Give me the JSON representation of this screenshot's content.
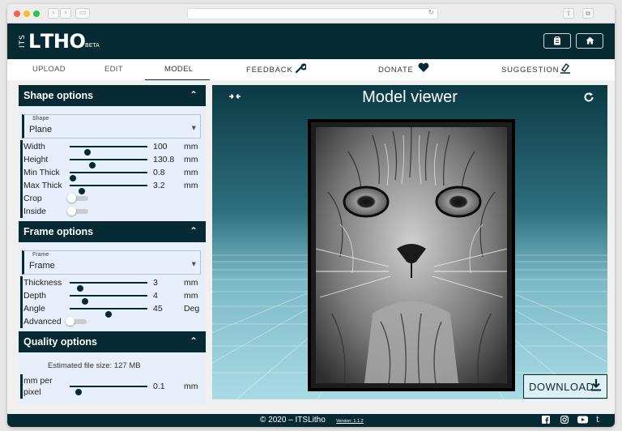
{
  "app": {
    "logo_prefix": "ITS",
    "logo_letter": "L",
    "logo_name": "THO",
    "logo_badge": "BETA",
    "header_icon_left": "clipboard-icon",
    "header_icon_right": "home-icon"
  },
  "tabs": [
    {
      "label": "UPLOAD",
      "active": false
    },
    {
      "label": "EDIT",
      "active": false
    },
    {
      "label": "MODEL",
      "active": true
    }
  ],
  "nav": {
    "feedback": "FEEDBACK",
    "donate": "DONATE",
    "suggestion": "SUGGESTION"
  },
  "shape_options": {
    "title": "Shape options",
    "select_label": "Shape",
    "select_value": "Plane",
    "sliders": [
      {
        "name": "Width",
        "value": "100",
        "unit": "mm",
        "fraction": 0.2
      },
      {
        "name": "Height",
        "value": "130.8",
        "unit": "mm",
        "fraction": 0.27
      },
      {
        "name": "Min Thick",
        "value": "0.8",
        "unit": "mm",
        "fraction": 0.0
      },
      {
        "name": "Max Thick",
        "value": "3.2",
        "unit": "mm",
        "fraction": 0.13
      }
    ],
    "toggles": [
      {
        "name": "Crop",
        "on": false
      },
      {
        "name": "Inside",
        "on": false
      }
    ]
  },
  "frame_options": {
    "title": "Frame options",
    "select_label": "Frame",
    "select_value": "Frame",
    "sliders": [
      {
        "name": "Thickness",
        "value": "3",
        "unit": "mm",
        "fraction": 0.1
      },
      {
        "name": "Depth",
        "value": "4",
        "unit": "mm",
        "fraction": 0.17
      },
      {
        "name": "Angle",
        "value": "45",
        "unit": "Deg",
        "fraction": 0.5
      }
    ],
    "toggles": [
      {
        "name": "Advanced",
        "on": false
      }
    ]
  },
  "quality_options": {
    "title": "Quality options",
    "estimate": "Estimated file size: 127 MB",
    "slider": {
      "name_line1": "mm per",
      "name_line2": "pixel",
      "value": "0.1",
      "unit": "mm",
      "fraction": 0.08
    }
  },
  "viewer": {
    "title": "Model viewer",
    "left_icon": "compress-arrows-icon",
    "right_icon": "refresh-icon",
    "download_label": "DOWNLOAD"
  },
  "footer": {
    "copyright": "© 2020 – ITSLitho",
    "version": "Version: 1.1.2",
    "social_icons": [
      "facebook-icon",
      "instagram-icon",
      "youtube-icon",
      "tumblr-icon"
    ]
  },
  "colors": {
    "primary": "#062a33",
    "panel_bg": "#e7effb"
  }
}
